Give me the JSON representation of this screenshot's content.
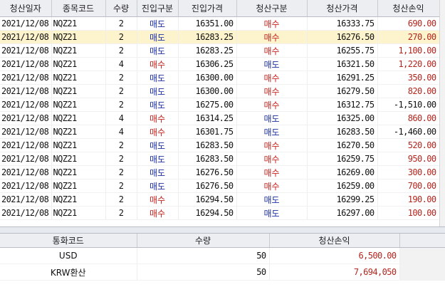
{
  "main_table": {
    "headers": [
      "청산일자",
      "종목코드",
      "수량",
      "진입구분",
      "진입가격",
      "청산구분",
      "청산가격",
      "청산손익"
    ],
    "rows": [
      {
        "date": "2021/12/08",
        "code": "NQZ21",
        "qty": "2",
        "entry_side": "매도",
        "entry_price": "16351.00",
        "exit_side": "매수",
        "exit_price": "16333.75",
        "pnl": "690.00"
      },
      {
        "date": "2021/12/08",
        "code": "NQZ21",
        "qty": "2",
        "entry_side": "매도",
        "entry_price": "16283.25",
        "exit_side": "매수",
        "exit_price": "16276.50",
        "pnl": "270.00"
      },
      {
        "date": "2021/12/08",
        "code": "NQZ21",
        "qty": "2",
        "entry_side": "매도",
        "entry_price": "16283.25",
        "exit_side": "매수",
        "exit_price": "16255.75",
        "pnl": "1,100.00"
      },
      {
        "date": "2021/12/08",
        "code": "NQZ21",
        "qty": "4",
        "entry_side": "매수",
        "entry_price": "16306.25",
        "exit_side": "매도",
        "exit_price": "16321.50",
        "pnl": "1,220.00"
      },
      {
        "date": "2021/12/08",
        "code": "NQZ21",
        "qty": "2",
        "entry_side": "매도",
        "entry_price": "16300.00",
        "exit_side": "매수",
        "exit_price": "16291.25",
        "pnl": "350.00"
      },
      {
        "date": "2021/12/08",
        "code": "NQZ21",
        "qty": "2",
        "entry_side": "매도",
        "entry_price": "16300.00",
        "exit_side": "매수",
        "exit_price": "16279.50",
        "pnl": "820.00"
      },
      {
        "date": "2021/12/08",
        "code": "NQZ21",
        "qty": "2",
        "entry_side": "매도",
        "entry_price": "16275.00",
        "exit_side": "매수",
        "exit_price": "16312.75",
        "pnl": "-1,510.00"
      },
      {
        "date": "2021/12/08",
        "code": "NQZ21",
        "qty": "4",
        "entry_side": "매수",
        "entry_price": "16314.25",
        "exit_side": "매도",
        "exit_price": "16325.00",
        "pnl": "860.00"
      },
      {
        "date": "2021/12/08",
        "code": "NQZ21",
        "qty": "4",
        "entry_side": "매수",
        "entry_price": "16301.75",
        "exit_side": "매도",
        "exit_price": "16283.50",
        "pnl": "-1,460.00"
      },
      {
        "date": "2021/12/08",
        "code": "NQZ21",
        "qty": "2",
        "entry_side": "매도",
        "entry_price": "16283.50",
        "exit_side": "매수",
        "exit_price": "16270.50",
        "pnl": "520.00"
      },
      {
        "date": "2021/12/08",
        "code": "NQZ21",
        "qty": "2",
        "entry_side": "매도",
        "entry_price": "16283.50",
        "exit_side": "매수",
        "exit_price": "16259.75",
        "pnl": "950.00"
      },
      {
        "date": "2021/12/08",
        "code": "NQZ21",
        "qty": "2",
        "entry_side": "매도",
        "entry_price": "16276.50",
        "exit_side": "매수",
        "exit_price": "16269.00",
        "pnl": "300.00"
      },
      {
        "date": "2021/12/08",
        "code": "NQZ21",
        "qty": "2",
        "entry_side": "매도",
        "entry_price": "16276.50",
        "exit_side": "매수",
        "exit_price": "16259.00",
        "pnl": "700.00"
      },
      {
        "date": "2021/12/08",
        "code": "NQZ21",
        "qty": "2",
        "entry_side": "매수",
        "entry_price": "16294.50",
        "exit_side": "매도",
        "exit_price": "16299.25",
        "pnl": "190.00"
      },
      {
        "date": "2021/12/08",
        "code": "NQZ21",
        "qty": "2",
        "entry_side": "매수",
        "entry_price": "16294.50",
        "exit_side": "매도",
        "exit_price": "16297.00",
        "pnl": "100.00"
      }
    ],
    "selected_row_index": 1
  },
  "summary_table": {
    "headers": [
      "통화코드",
      "수량",
      "청산손익"
    ],
    "rows": [
      {
        "currency": "USD",
        "qty": "50",
        "pnl": "6,500.00"
      },
      {
        "currency": "KRW환산",
        "qty": "50",
        "pnl": "7,694,050"
      }
    ]
  },
  "colors": {
    "sell_text": "#1a2fa3",
    "buy_text": "#c4241e",
    "profit_text": "#b3261e",
    "loss_text": "#111111",
    "selected_row_bg": "#fdf3cc",
    "header_bg": "#eceef2"
  }
}
